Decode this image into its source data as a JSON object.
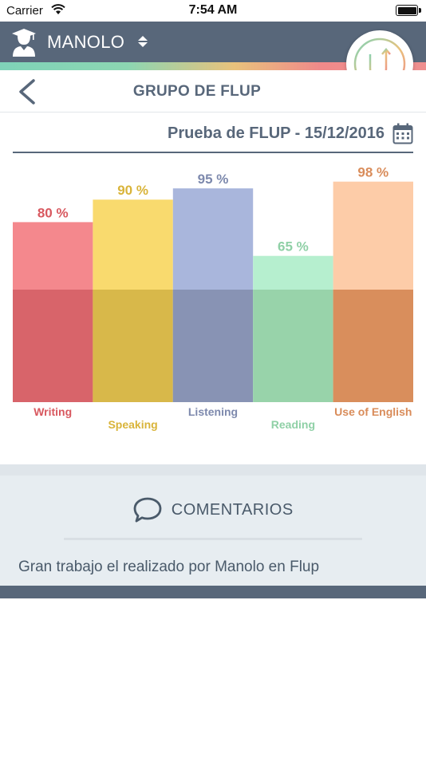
{
  "status_bar": {
    "carrier": "Carrier",
    "time": "7:54 AM"
  },
  "header": {
    "user_name": "MANOLO"
  },
  "nav": {
    "title": "GRUPO DE FLUP"
  },
  "test_selector": {
    "label": "Prueba de FLUP - 15/12/2016"
  },
  "chart_data": {
    "type": "bar",
    "categories": [
      "Writing",
      "Speaking",
      "Listening",
      "Reading",
      "Use of English"
    ],
    "values": [
      80,
      90,
      95,
      65,
      98
    ],
    "value_labels": [
      "80 %",
      "90 %",
      "95 %",
      "65 %",
      "98 %"
    ],
    "ylim": [
      0,
      100
    ],
    "grid": false,
    "colors_light": [
      "#f4888d",
      "#f9da6e",
      "#a9b6dc",
      "#b6efcf",
      "#fdcca8"
    ],
    "colors_dark": [
      "#d8646a",
      "#d8b84a",
      "#8893b4",
      "#98d3aa",
      "#d98e5c"
    ],
    "label_colors": [
      "#d8585f",
      "#d9b43a",
      "#7d89ad",
      "#8fd0a6",
      "#d98c5a"
    ]
  },
  "comments": {
    "title": "COMENTARIOS",
    "text": "Gran trabajo el realizado por Manolo en Flup"
  }
}
